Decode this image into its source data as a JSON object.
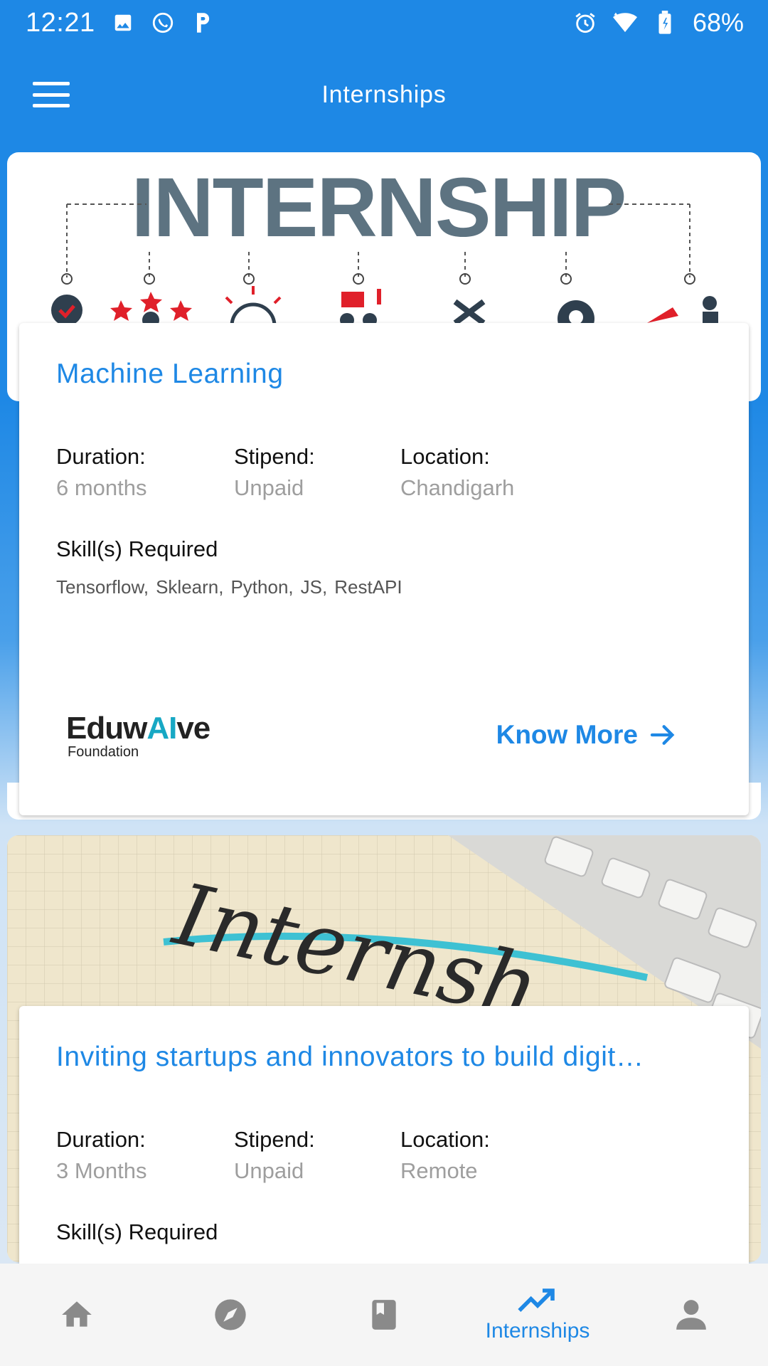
{
  "status_bar": {
    "time": "12:21",
    "battery": "68%"
  },
  "app_bar": {
    "title": "Internships"
  },
  "cards": [
    {
      "banner_text": "INTERNSHIP",
      "title": "Machine Learning",
      "duration_label": "Duration:",
      "duration": "6 months",
      "stipend_label": "Stipend:",
      "stipend": "Unpaid",
      "location_label": "Location:",
      "location": "Chandigarh",
      "skills_heading": "Skill(s) Required",
      "skills": [
        "Tensorflow",
        "Sklearn",
        "Python",
        "JS",
        "RestAPI"
      ],
      "org_logo_main_pre": "Eduw",
      "org_logo_main_ai": "AI",
      "org_logo_main_post": "ve",
      "org_logo_sub": "Foundation",
      "cta": "Know More"
    },
    {
      "banner_text": "Internsh",
      "title": "Inviting startups and innovators to build digit…",
      "duration_label": "Duration:",
      "duration": "3 Months",
      "stipend_label": "Stipend:",
      "stipend": "Unpaid",
      "location_label": "Location:",
      "location": "Remote",
      "skills_heading": "Skill(s) Required"
    }
  ],
  "bottom_nav": {
    "active_label": "Internships"
  },
  "colors": {
    "primary": "#1e88e5",
    "muted": "#9e9e9e"
  }
}
